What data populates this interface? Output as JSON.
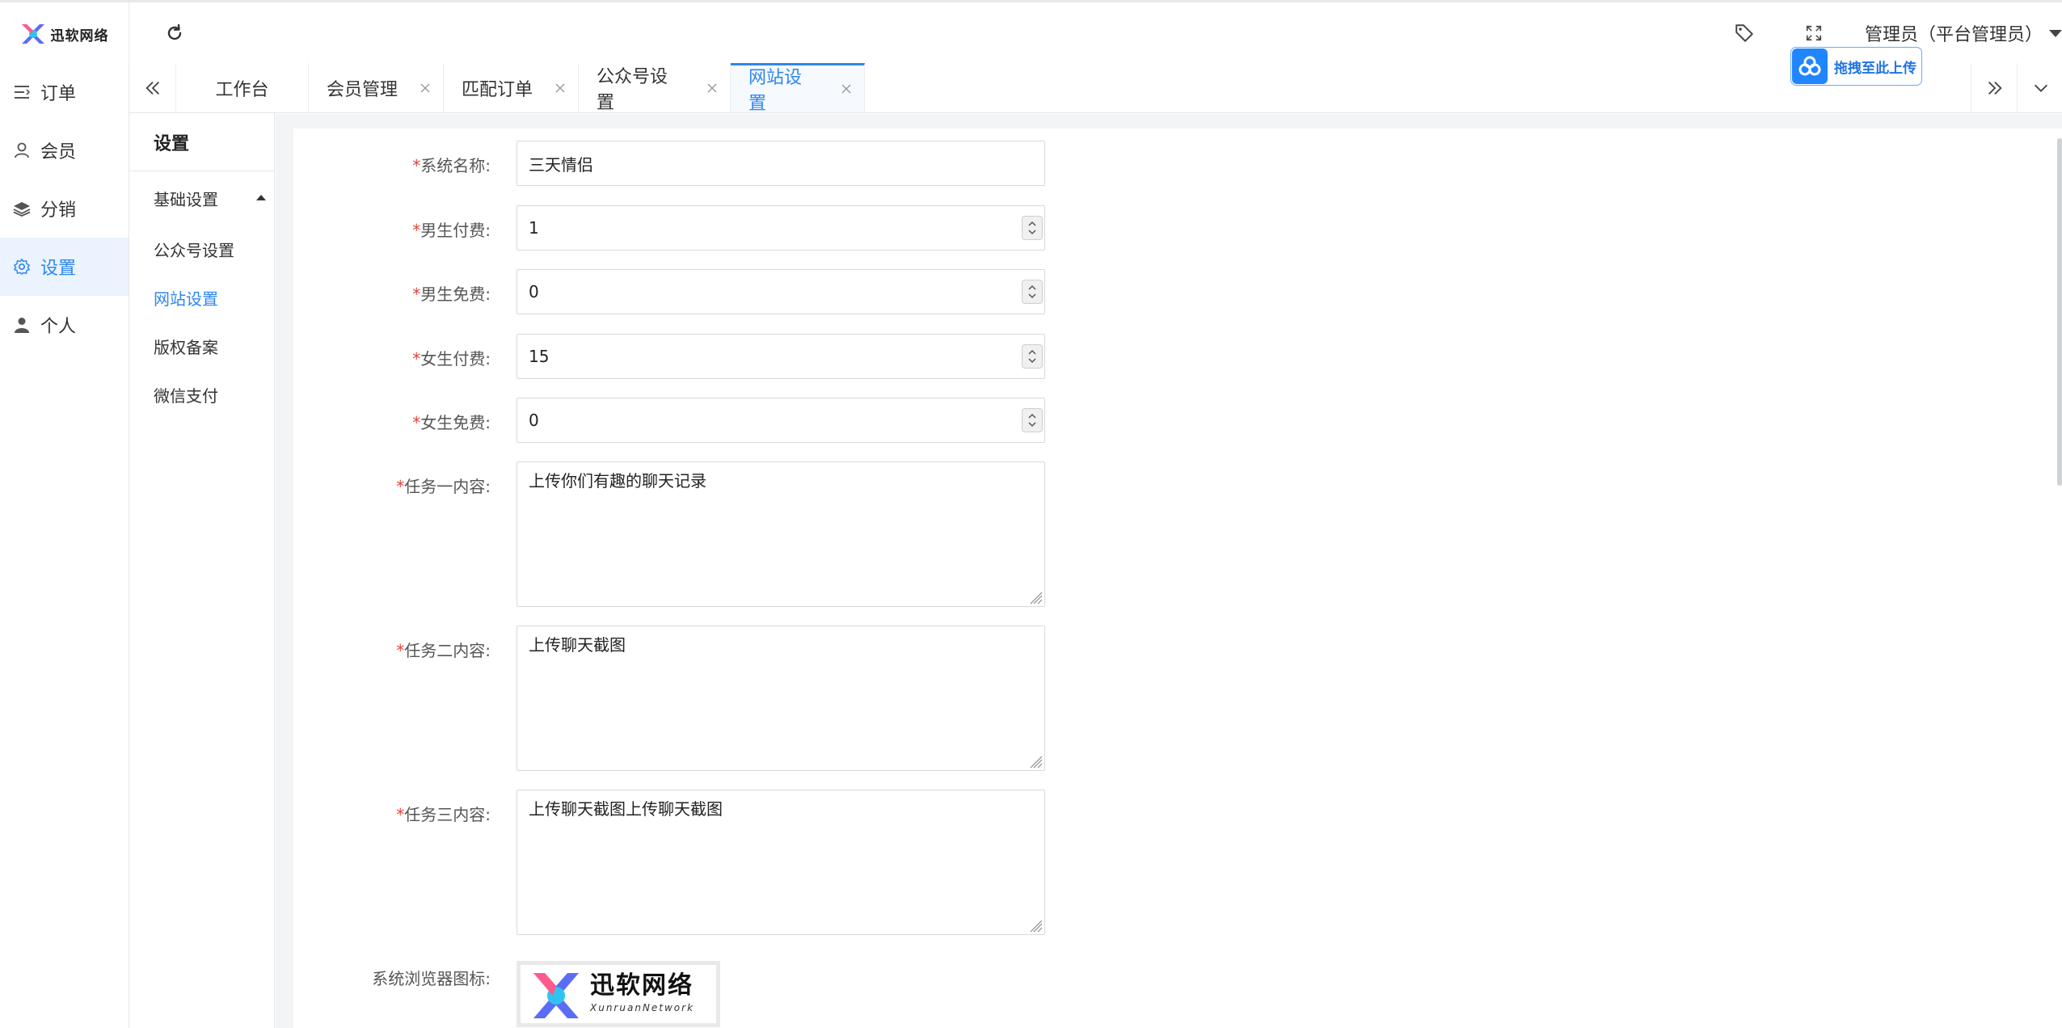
{
  "brand": {
    "logo_text": "迅软网络",
    "logo_subtext": "XunruanNetwork"
  },
  "header": {
    "admin_label": "管理员（平台管理员）"
  },
  "upload_badge": {
    "label": "拖拽至此上传"
  },
  "sidebar": {
    "items": [
      {
        "label": "订单",
        "icon": "list-icon"
      },
      {
        "label": "会员",
        "icon": "user-outline-icon"
      },
      {
        "label": "分销",
        "icon": "layers-icon"
      },
      {
        "label": "设置",
        "icon": "gear-icon",
        "active": true
      },
      {
        "label": "个人",
        "icon": "person-icon"
      }
    ]
  },
  "tabs": [
    {
      "label": "工作台",
      "closable": false
    },
    {
      "label": "会员管理",
      "closable": true
    },
    {
      "label": "匹配订单",
      "closable": true
    },
    {
      "label": "公众号设置",
      "closable": true
    },
    {
      "label": "网站设置",
      "closable": true,
      "active": true
    }
  ],
  "subnav": {
    "title": "设置",
    "group": "基础设置",
    "items": [
      {
        "label": "公众号设置"
      },
      {
        "label": "网站设置",
        "active": true
      },
      {
        "label": "版权备案"
      },
      {
        "label": "微信支付"
      }
    ]
  },
  "form": {
    "required_mark": "*",
    "system_name": {
      "label": "系统名称:",
      "value": "三天情侣"
    },
    "male_paid": {
      "label": "男生付费:",
      "value": "1"
    },
    "male_free": {
      "label": "男生免费:",
      "value": "0"
    },
    "female_paid": {
      "label": "女生付费:",
      "value": "15"
    },
    "female_free": {
      "label": "女生免费:",
      "value": "0"
    },
    "task_one": {
      "label": "任务一内容:",
      "value": "上传你们有趣的聊天记录"
    },
    "task_two": {
      "label": "任务二内容:",
      "value": "上传聊天截图"
    },
    "task_three": {
      "label": "任务三内容:",
      "value": "上传聊天截图上传聊天截图"
    },
    "favicon": {
      "label": "系统浏览器图标:"
    }
  },
  "colors": {
    "accent": "#2e86f0",
    "required": "#e5413b",
    "upload": "#1f86ff"
  }
}
